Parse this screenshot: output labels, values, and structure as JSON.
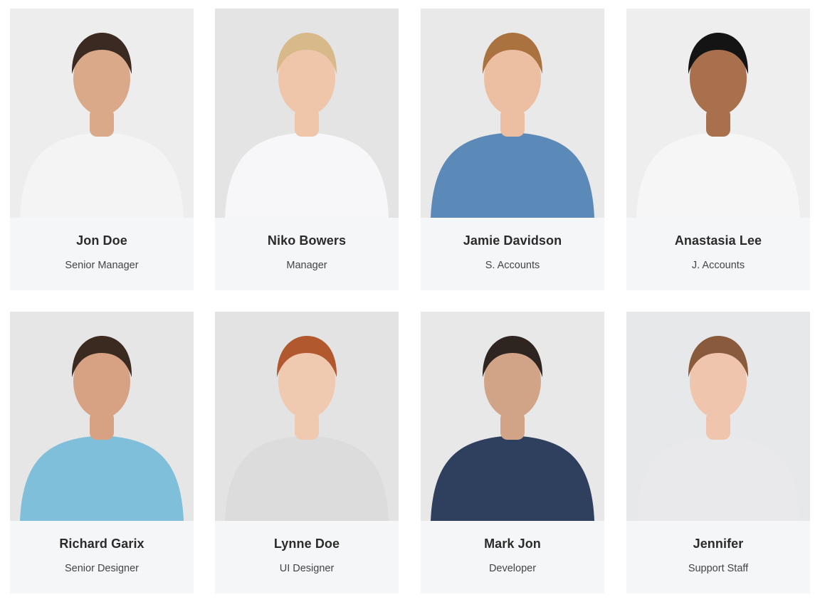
{
  "team": {
    "members": [
      {
        "name": "Jon Doe",
        "role": "Senior Manager",
        "photo": "portrait-man-beard-white-tee",
        "bg": "#ededed",
        "skin": "#d9a98a",
        "hair": "#3a2a22",
        "shirt": "#f4f4f4"
      },
      {
        "name": "Niko Bowers",
        "role": "Manager",
        "photo": "portrait-woman-glasses-polka-dot",
        "bg": "#e4e4e4",
        "skin": "#f0c6ab",
        "hair": "#d8b98a",
        "shirt": "#f7f7f9"
      },
      {
        "name": "Jamie Davidson",
        "role": "S. Accounts",
        "photo": "portrait-man-red-beard-denim",
        "bg": "#e9e9e9",
        "skin": "#ecbfa2",
        "hair": "#a9723f",
        "shirt": "#5b89b8"
      },
      {
        "name": "Anastasia Lee",
        "role": "J. Accounts",
        "photo": "portrait-woman-curly-hair-glasses",
        "bg": "#eeeeee",
        "skin": "#a8704c",
        "hair": "#141414",
        "shirt": "#f6f6f6"
      },
      {
        "name": "Richard Garix",
        "role": "Senior Designer",
        "photo": "portrait-man-beard-blue-polo",
        "bg": "#e6e6e6",
        "skin": "#d7a184",
        "hair": "#3b2a20",
        "shirt": "#7fbfd9"
      },
      {
        "name": "Lynne Doe",
        "role": "UI Designer",
        "photo": "portrait-woman-red-hair-bun",
        "bg": "#e3e3e3",
        "skin": "#f0c9b1",
        "hair": "#b2582e",
        "shirt": "#dcdcdc"
      },
      {
        "name": "Mark Jon",
        "role": "Developer",
        "photo": "portrait-man-glasses-navy-shirt",
        "bg": "#e8e8e8",
        "skin": "#d2a487",
        "hair": "#2e2520",
        "shirt": "#2f3f5e"
      },
      {
        "name": "Jennifer",
        "role": "Support Staff",
        "photo": "portrait-woman-bob-grey-sweater",
        "bg": "#e7e8ea",
        "skin": "#efc5ad",
        "hair": "#8a5a3c",
        "shirt": "#e9e9ec"
      }
    ]
  },
  "colors": {
    "card_bg": "#f5f6f8",
    "name_text": "#2b2b2b",
    "role_text": "#444444"
  }
}
